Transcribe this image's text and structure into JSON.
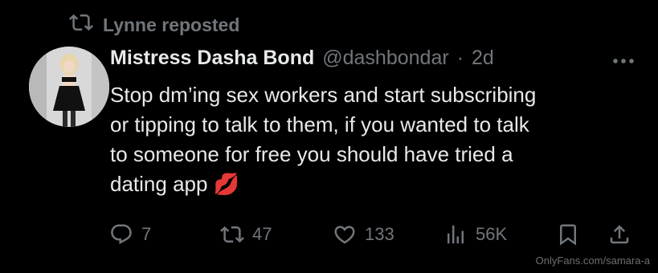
{
  "repost": {
    "label": "Lynne reposted",
    "icon": "repost-icon"
  },
  "author": {
    "name": "Mistress Dasha Bond",
    "handle": "@dashbondar",
    "separator": "·",
    "age": "2d"
  },
  "tweet": {
    "lines": [
      "Stop dm’ing sex workers and start subscribing",
      "or tipping to talk to them, if you wanted to talk",
      "to someone for free you should have tried a",
      "dating app 💋"
    ]
  },
  "actions": {
    "replies": "7",
    "reposts": "47",
    "likes": "133",
    "views": "56K"
  },
  "colors": {
    "background": "#000000",
    "text": "#e7e9ea",
    "muted": "#71767b"
  },
  "watermark": "OnlyFans.com/samara-a"
}
